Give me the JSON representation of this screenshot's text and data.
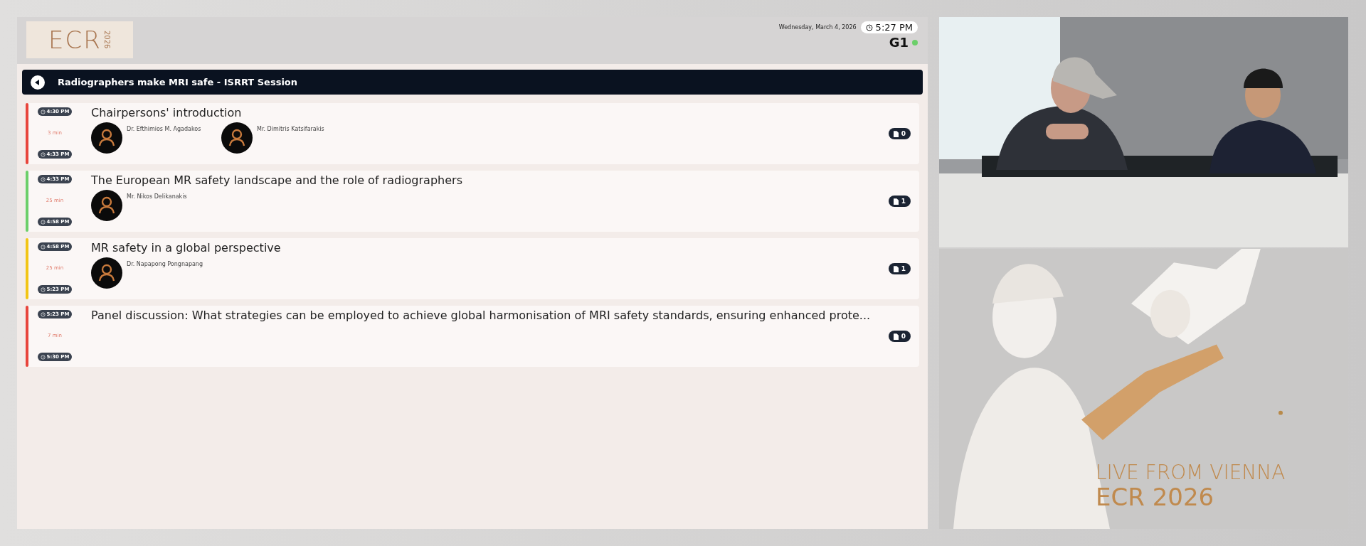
{
  "header": {
    "logo": {
      "mark": "ECR",
      "year": "2026"
    },
    "date": "Wednesday, March 4, 2026",
    "time": "5:27 PM",
    "room": "G1",
    "room_live": true
  },
  "session": {
    "title": "Radiographers make MRI safe - ISRRT Session"
  },
  "talks": [
    {
      "color": "#e8453c",
      "start": "4:30 PM",
      "duration": "3 min",
      "end": "4:33 PM",
      "title": "Chairpersons' introduction",
      "speakers": [
        "Dr. Efthimios M. Agadakos",
        "Mr. Dimitris Katsifarakis"
      ],
      "documents": "0"
    },
    {
      "color": "#6ccf6a",
      "start": "4:33 PM",
      "duration": "25 min",
      "end": "4:58 PM",
      "title": "The European MR safety landscape and the role of radiographers",
      "speakers": [
        "Mr. Nikos Delikanakis"
      ],
      "documents": "1"
    },
    {
      "color": "#f2c515",
      "start": "4:58 PM",
      "duration": "25 min",
      "end": "5:23 PM",
      "title": "MR safety in a global perspective",
      "speakers": [
        "Dr. Napapong Pongnapang"
      ],
      "documents": "1"
    },
    {
      "color": "#e8453c",
      "start": "5:23 PM",
      "duration": "7 min",
      "end": "5:30 PM",
      "title": "Panel discussion: What strategies can be employed to achieve global harmonisation of MRI safety standards, ensuring enhanced prote...",
      "documents": "0"
    }
  ],
  "stream": {
    "tagline": "LIVE FROM VIENNA",
    "event": "ECR 2026"
  }
}
